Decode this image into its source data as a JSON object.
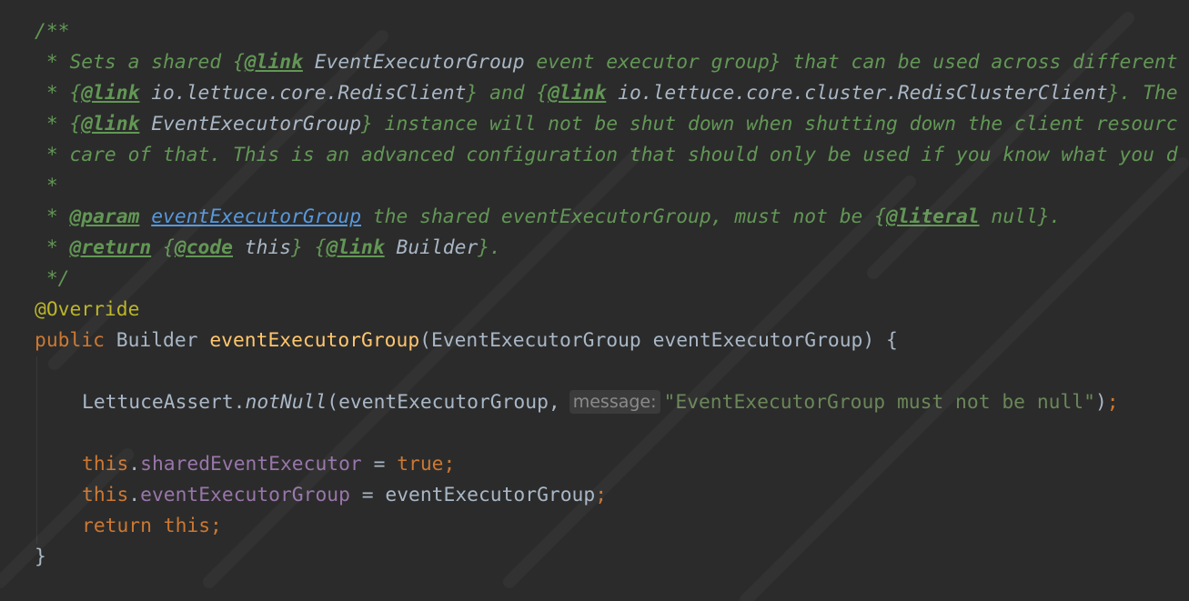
{
  "theme": {
    "background": "#2b2b2b",
    "doc_comment": "#629755",
    "keyword": "#cc7832",
    "method_decl": "#ffc66d",
    "field": "#9876aa",
    "string": "#6a8759",
    "annotation": "#bbb529",
    "plain": "#a9b7c6",
    "param_ref": "#5798db"
  },
  "javadoc": {
    "open": "/**",
    "line1": {
      "star_text": " * Sets a shared {",
      "tag": "@link",
      "ref": " EventExecutorGroup",
      "rest": " event executor group} that can be used across different"
    },
    "line2": {
      "star": " * {",
      "tag1": "@link",
      "ref1": " io.lettuce.core.RedisClient",
      "mid": "} and {",
      "tag2": "@link",
      "ref2": " io.lettuce.core.cluster.RedisClusterClient",
      "rest": "}. The"
    },
    "line3": {
      "star": " * {",
      "tag": "@link",
      "ref": " EventExecutorGroup",
      "rest": "} instance will not be shut down when shutting down the client resourc"
    },
    "line4": " * care of that. This is an advanced configuration that should only be used if you know what you d",
    "line5": " *",
    "line6": {
      "star": " * ",
      "tag": "@param",
      "param": "eventExecutorGroup",
      "rest1": " the shared eventExecutorGroup, must not be {",
      "literal_tag": "@literal",
      "rest2": " null}."
    },
    "line7": {
      "star": " * ",
      "tag": "@return",
      "brace1": " {",
      "code_tag": "@code",
      "code_val": " this",
      "brace2": "} {",
      "link_tag": "@link",
      "link_val": " Builder",
      "end": "}."
    },
    "close": " */"
  },
  "method": {
    "annotation": "@Override",
    "modifier": "public",
    "return_type": " Builder ",
    "name": "eventExecutorGroup",
    "params": "(EventExecutorGroup eventExecutorGroup) {",
    "assert_class": "LettuceAssert.",
    "assert_method": "notNull",
    "assert_args": "(eventExecutorGroup,",
    "param_hint": "message:",
    "assert_message": "\"EventExecutorGroup must not be null\"",
    "assert_close": ")",
    "semicolon": ";",
    "this_kw": "this",
    "dot": ".",
    "field1": "sharedEventExecutor",
    "assign": " = ",
    "true_kw": "true",
    "field2": "eventExecutorGroup",
    "rhs2": "eventExecutorGroup",
    "return_kw": "return",
    "return_val": " this",
    "close_brace": "}"
  }
}
